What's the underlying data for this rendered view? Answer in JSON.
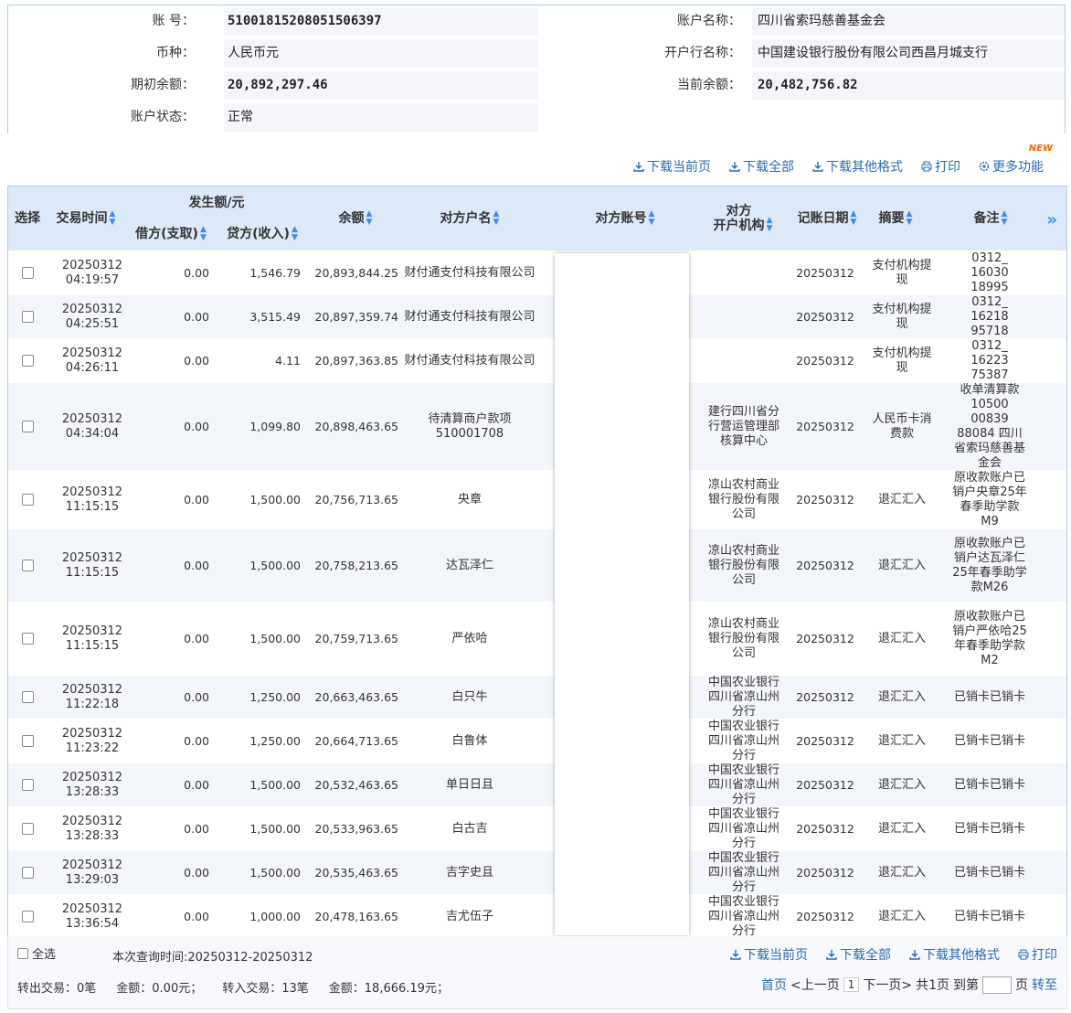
{
  "account": {
    "number_label": "账      号：",
    "number": "51001815208051506397",
    "name_label": "账户名称：",
    "name": "四川省索玛慈善基金会",
    "currency_label": "币种：",
    "currency": "人民币元",
    "bank_label": "开户行名称：",
    "bank": "中国建设银行股份有限公司西昌月城支行",
    "opening_balance_label": "期初余额：",
    "opening_balance": "20,892,297.46",
    "current_balance_label": "当前余额：",
    "current_balance": "20,482,756.82",
    "status_label": "账户状态：",
    "status": "正常"
  },
  "toolbar": {
    "download_page": "下载当前页",
    "download_all": "下载全部",
    "download_other": "下载其他格式",
    "print": "打印",
    "more": "更多功能",
    "new_badge": "NEW"
  },
  "table": {
    "headers": {
      "select": "选择",
      "time": "交易时间",
      "amount_group": "发生额/元",
      "debit": "借方(支取)",
      "credit": "贷方(收入)",
      "balance": "余额",
      "counterparty": "对方户名",
      "account": "对方账号",
      "bank_line1": "对方",
      "bank_line2": "开户机构",
      "date": "记账日期",
      "summary": "摘要",
      "remark": "备注"
    },
    "rows": [
      {
        "t1": "20250312",
        "t2": "04:19:57",
        "debit": "0.00",
        "credit": "1,546.79",
        "balance": "20,893,844.25",
        "party": "财付通支付科技有限公司",
        "bank": "",
        "date": "20250312",
        "summary": "支付机构提现",
        "remark": "0312_ 16030 18995"
      },
      {
        "t1": "20250312",
        "t2": "04:25:51",
        "debit": "0.00",
        "credit": "3,515.49",
        "balance": "20,897,359.74",
        "party": "财付通支付科技有限公司",
        "bank": "",
        "date": "20250312",
        "summary": "支付机构提现",
        "remark": "0312_ 16218 95718"
      },
      {
        "t1": "20250312",
        "t2": "04:26:11",
        "debit": "0.00",
        "credit": "4.11",
        "balance": "20,897,363.85",
        "party": "财付通支付科技有限公司",
        "bank": "",
        "date": "20250312",
        "summary": "支付机构提现",
        "remark": "0312_ 16223 75387"
      },
      {
        "t1": "20250312",
        "t2": "04:34:04",
        "debit": "0.00",
        "credit": "1,099.80",
        "balance": "20,898,463.65",
        "party": "待清算商户款项510001708",
        "bank": "建行四川省分行营运管理部核算中心",
        "date": "20250312",
        "summary": "人民币卡消费款",
        "remark": "收单清算款 10500 00839 88084 四川省索玛慈善基金会"
      },
      {
        "t1": "20250312",
        "t2": "11:15:15",
        "debit": "0.00",
        "credit": "1,500.00",
        "balance": "20,756,713.65",
        "party": "央章",
        "bank": "凉山农村商业银行股份有限公司",
        "date": "20250312",
        "summary": "退汇汇入",
        "remark": "原收款账户已销户央章25年春季助学款M9"
      },
      {
        "t1": "20250312",
        "t2": "11:15:15",
        "debit": "0.00",
        "credit": "1,500.00",
        "balance": "20,758,213.65",
        "party": "达瓦泽仁",
        "bank": "凉山农村商业银行股份有限公司",
        "date": "20250312",
        "summary": "退汇汇入",
        "remark": "原收款账户已销户达瓦泽仁25年春季助学款M26"
      },
      {
        "t1": "20250312",
        "t2": "11:15:15",
        "debit": "0.00",
        "credit": "1,500.00",
        "balance": "20,759,713.65",
        "party": "严依哈",
        "bank": "凉山农村商业银行股份有限公司",
        "date": "20250312",
        "summary": "退汇汇入",
        "remark": "原收款账户已销户严依哈25年春季助学款M2"
      },
      {
        "t1": "20250312",
        "t2": "11:22:18",
        "debit": "0.00",
        "credit": "1,250.00",
        "balance": "20,663,463.65",
        "party": "白只牛",
        "bank": "中国农业银行四川省凉山州分行",
        "date": "20250312",
        "summary": "退汇汇入",
        "remark": "已销卡已销卡"
      },
      {
        "t1": "20250312",
        "t2": "11:23:22",
        "debit": "0.00",
        "credit": "1,250.00",
        "balance": "20,664,713.65",
        "party": "白鲁体",
        "bank": "中国农业银行四川省凉山州分行",
        "date": "20250312",
        "summary": "退汇汇入",
        "remark": "已销卡已销卡"
      },
      {
        "t1": "20250312",
        "t2": "13:28:33",
        "debit": "0.00",
        "credit": "1,500.00",
        "balance": "20,532,463.65",
        "party": "单日日且",
        "bank": "中国农业银行四川省凉山州分行",
        "date": "20250312",
        "summary": "退汇汇入",
        "remark": "已销卡已销卡"
      },
      {
        "t1": "20250312",
        "t2": "13:28:33",
        "debit": "0.00",
        "credit": "1,500.00",
        "balance": "20,533,963.65",
        "party": "白古吉",
        "bank": "中国农业银行四川省凉山州分行",
        "date": "20250312",
        "summary": "退汇汇入",
        "remark": "已销卡已销卡"
      },
      {
        "t1": "20250312",
        "t2": "13:29:03",
        "debit": "0.00",
        "credit": "1,500.00",
        "balance": "20,535,463.65",
        "party": "吉字史且",
        "bank": "中国农业银行四川省凉山州分行",
        "date": "20250312",
        "summary": "退汇汇入",
        "remark": "已销卡已销卡"
      },
      {
        "t1": "20250312",
        "t2": "13:36:54",
        "debit": "0.00",
        "credit": "1,000.00",
        "balance": "20,478,163.65",
        "party": "吉尤伍子",
        "bank": "中国农业银行四川省凉山州分行",
        "date": "20250312",
        "summary": "退汇汇入",
        "remark": "已销卡已销卡"
      }
    ]
  },
  "footer": {
    "select_all": "全选",
    "query_time": "本次查询时间:20250312-20250312",
    "download_page": "下载当前页",
    "download_all": "下载全部",
    "download_other": "下载其他格式",
    "print": "打印",
    "out_tx": "转出交易：0笔",
    "out_amount": "金额：0.00元；",
    "in_tx": "转入交易：13笔",
    "in_amount": "金额：18,666.19元；",
    "first": "首页",
    "prev": "<上一页",
    "page": "1",
    "next": "下一页>",
    "total": "共1页",
    "goto": "到第",
    "page_unit": "页",
    "go": "转至"
  }
}
